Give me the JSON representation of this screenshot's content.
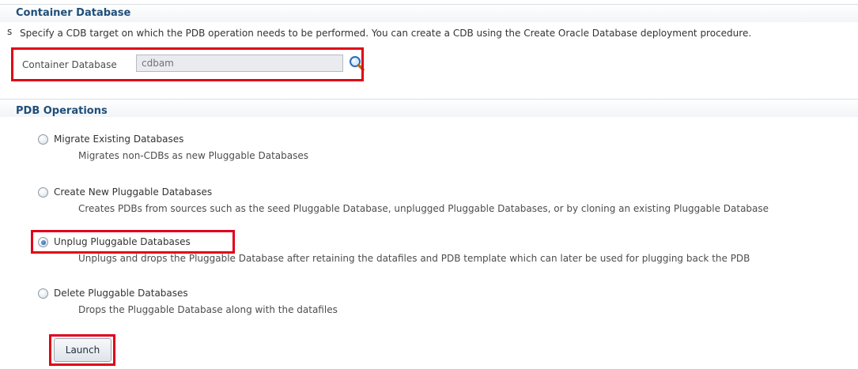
{
  "container_section": {
    "title": "Container Database",
    "description": "Specify a CDB target on which the PDB operation needs to be performed. You can create a CDB using the Create Oracle Database deployment procedure.",
    "field_label": "Container Database",
    "field_value": "cdbam",
    "search_icon": "search-icon"
  },
  "pdb_section": {
    "title": "PDB Operations",
    "options": [
      {
        "label": "Migrate Existing Databases",
        "help": "Migrates non-CDBs as new Pluggable Databases",
        "selected": false
      },
      {
        "label": "Create New Pluggable Databases",
        "help": "Creates PDBs from sources such as the seed Pluggable Database, unplugged Pluggable Databases, or by cloning an existing Pluggable Database",
        "selected": false
      },
      {
        "label": "Unplug Pluggable Databases",
        "help": "Unplugs and drops the Pluggable Database after retaining the datafiles and PDB template which can later be used for plugging back the PDB",
        "selected": true
      },
      {
        "label": "Delete Pluggable Databases",
        "help": "Drops the Pluggable Database along with the datafiles",
        "selected": false
      }
    ],
    "launch_label": "Launch"
  },
  "colors": {
    "highlight": "#e0001a",
    "section_title": "#1f4e79"
  }
}
